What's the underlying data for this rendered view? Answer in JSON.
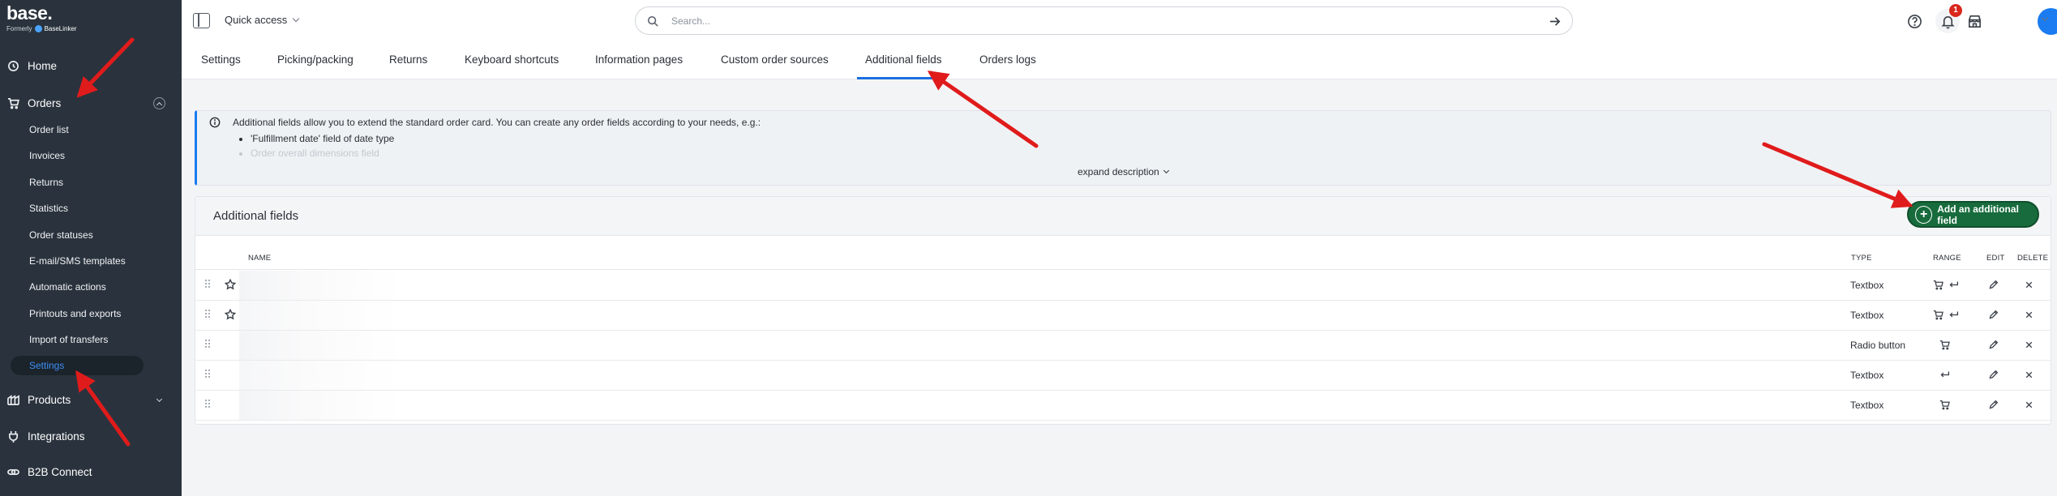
{
  "brand": {
    "logo": "base.",
    "formerly": "Formerly",
    "formerly_name": "BaseLinker"
  },
  "sidebar": {
    "main": [
      {
        "label": "Home",
        "icon": "home-icon"
      },
      {
        "label": "Orders",
        "icon": "cart-icon",
        "expanded": true
      },
      {
        "label": "Products",
        "icon": "products-icon"
      },
      {
        "label": "Integrations",
        "icon": "plug-icon"
      },
      {
        "label": "B2B Connect",
        "icon": "link-icon"
      }
    ],
    "orders_sub": [
      "Order list",
      "Invoices",
      "Returns",
      "Statistics",
      "Order statuses",
      "E-mail/SMS templates",
      "Automatic actions",
      "Printouts and exports",
      "Import of transfers",
      "Settings"
    ],
    "active_sub": "Settings"
  },
  "topbar": {
    "quick_access": "Quick access",
    "search_placeholder": "Search...",
    "notifications_count": "1"
  },
  "tabs": [
    "Settings",
    "Picking/packing",
    "Returns",
    "Keyboard shortcuts",
    "Information pages",
    "Custom order sources",
    "Additional fields",
    "Orders logs"
  ],
  "active_tab": "Additional fields",
  "info": {
    "text": "Additional fields allow you to extend the standard order card. You can create any order fields according to your needs, e.g.:",
    "bullets": [
      "'Fulfillment date' field of date type",
      "Order overall dimensions field"
    ],
    "expand_label": "expand description"
  },
  "panel": {
    "title": "Additional fields",
    "add_button": "Add an additional field",
    "columns": {
      "name": "NAME",
      "type": "TYPE",
      "range": "RANGE",
      "edit": "EDIT",
      "delete": "DELETE"
    },
    "rows": [
      {
        "type": "Textbox",
        "starred": true,
        "range": [
          "cart-icon",
          "return-icon"
        ]
      },
      {
        "type": "Textbox",
        "starred": true,
        "range": [
          "cart-icon",
          "return-icon"
        ]
      },
      {
        "type": "Radio button",
        "starred": false,
        "range": [
          "cart-icon"
        ]
      },
      {
        "type": "Textbox",
        "starred": false,
        "range": [
          "return-icon"
        ]
      },
      {
        "type": "Textbox",
        "starred": false,
        "range": [
          "cart-icon"
        ]
      }
    ]
  },
  "colors": {
    "sidebar": "#2a333d",
    "accent": "#1a6fe0",
    "add_button": "#176b3c",
    "annotation": "#e01b1b",
    "badge": "#d9281c"
  }
}
